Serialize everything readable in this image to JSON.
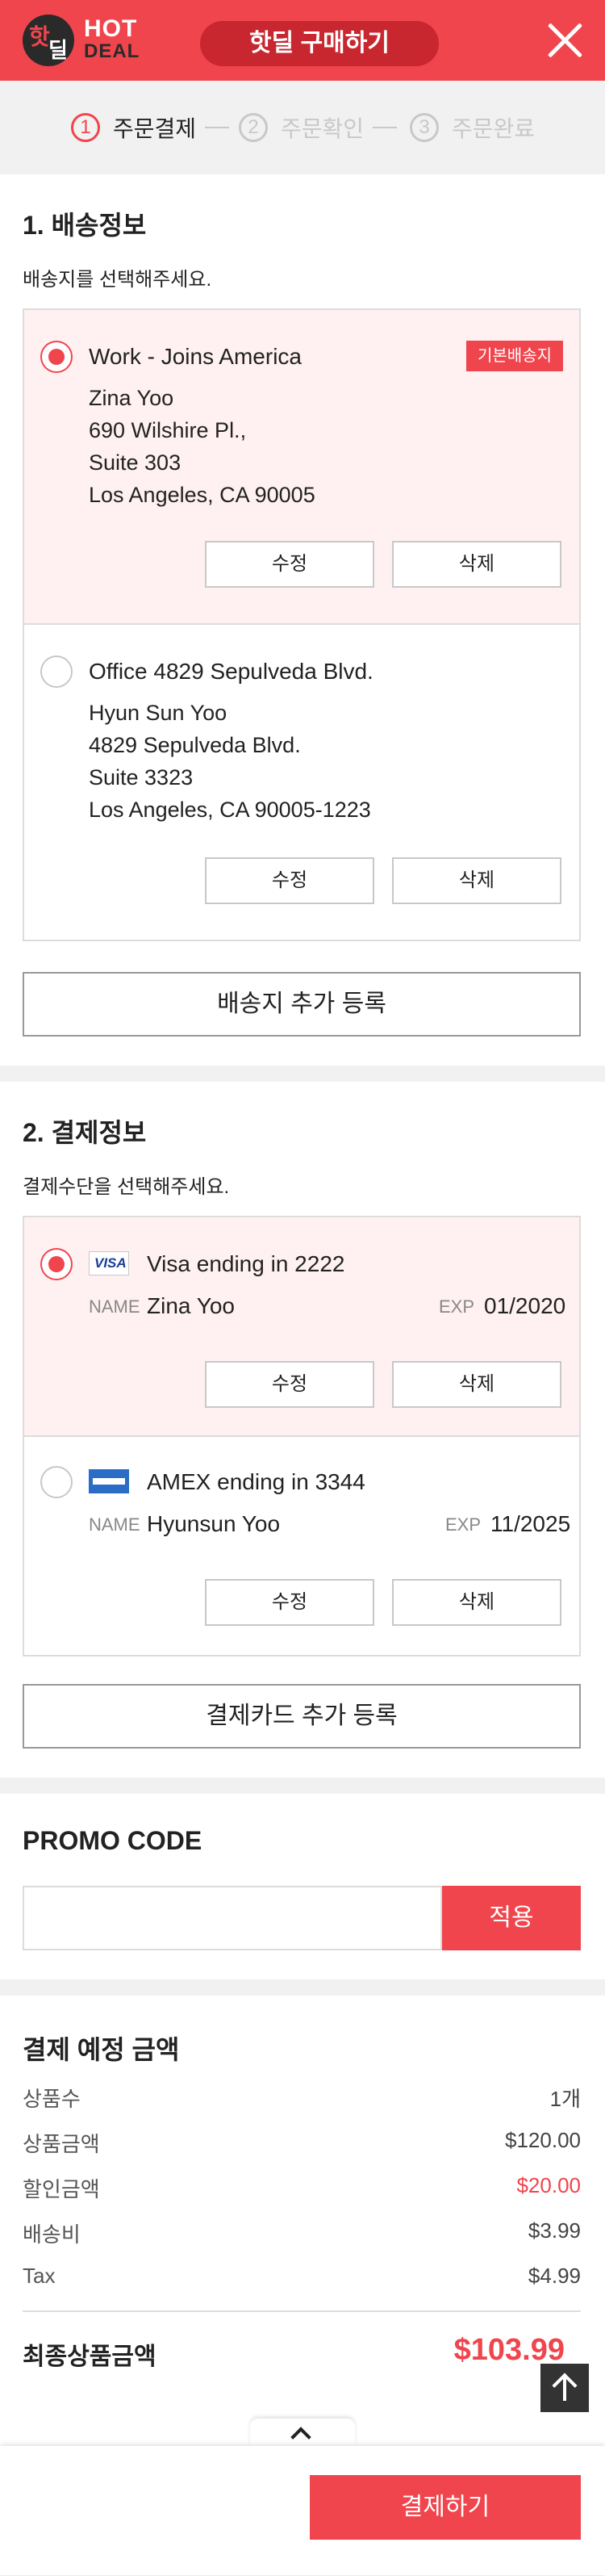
{
  "header": {
    "logo_icon_top": "핫",
    "logo_icon_bottom": "딜",
    "logo_text_top": "HOT",
    "logo_text_bottom": "DEAL",
    "title": "핫딜 구매하기"
  },
  "steps": [
    {
      "num": "①",
      "label": "주문결제",
      "active": true
    },
    {
      "num": "②",
      "label": "주문확인",
      "active": false
    },
    {
      "num": "③",
      "label": "주문완료",
      "active": false
    }
  ],
  "shipping": {
    "title": "1. 배송정보",
    "subtitle": "배송지를 선택해주세요.",
    "addresses": [
      {
        "name": "Work - Joins America",
        "badge": "기본배송지",
        "lines": [
          "Zina Yoo",
          "690 Wilshire Pl.,",
          "Suite 303",
          "Los Angeles, CA 90005"
        ],
        "selected": true
      },
      {
        "name": "Office 4829 Sepulveda Blvd.",
        "lines": [
          "Hyun Sun Yoo",
          "4829 Sepulveda Blvd.",
          "Suite 3323",
          "Los Angeles, CA 90005-1223"
        ],
        "selected": false
      }
    ],
    "edit_label": "수정",
    "delete_label": "삭제",
    "add_label": "배송지 추가 등록"
  },
  "payment": {
    "title": "2. 결제정보",
    "subtitle": "결제수단을 선택해주세요.",
    "name_label": "NAME",
    "exp_label": "EXP",
    "cards": [
      {
        "brand_icon": "visa-card-icon",
        "brand_text": "VISA",
        "title": "Visa ending in 2222",
        "name": "Zina Yoo",
        "exp": "01/2020",
        "selected": true
      },
      {
        "brand_icon": "amex-card-icon",
        "title": "AMEX ending in 3344",
        "name": "Hyunsun Yoo",
        "exp": "11/2025",
        "selected": false
      }
    ],
    "edit_label": "수정",
    "delete_label": "삭제",
    "add_label": "결제카드 추가 등록"
  },
  "promo": {
    "title": "PROMO CODE",
    "value": "",
    "apply_label": "적용"
  },
  "summary": {
    "title": "결제 예정 금액",
    "rows": [
      {
        "label": "상품수",
        "value": "1개"
      },
      {
        "label": "상품금액",
        "value": "$120.00"
      },
      {
        "label": "할인금액",
        "value": "$20.00",
        "highlight": true
      },
      {
        "label": "배송비",
        "value": "$3.99"
      },
      {
        "label": "Tax",
        "value": "$4.99"
      }
    ],
    "final_label": "최종상품금액",
    "final_value": "$103.99"
  },
  "bottom": {
    "pay_label": "결제하기"
  },
  "colors": {
    "accent": "#f0454d",
    "selected_bg": "#fff1f1"
  }
}
